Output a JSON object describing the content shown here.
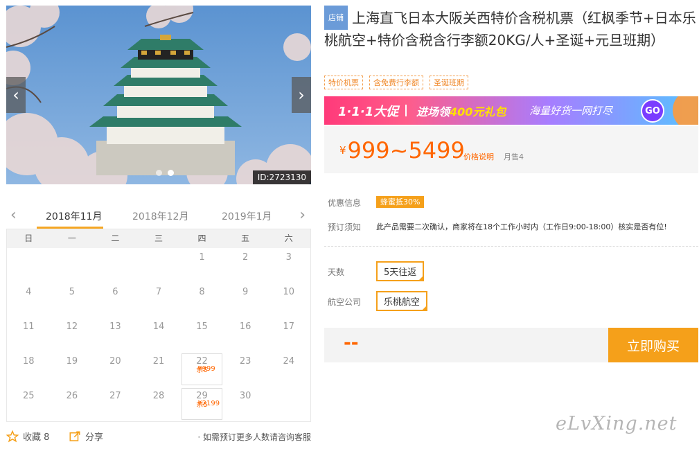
{
  "gallery": {
    "image_id": "ID:2723130",
    "prev_icon": "chevron-left-icon",
    "next_icon": "chevron-right-icon",
    "slide_count": 2,
    "active_slide": 2
  },
  "calendar": {
    "months": [
      "2018年11月",
      "2018年12月",
      "2019年1月"
    ],
    "active_month": "2018年11月",
    "weekdays": [
      "日",
      "一",
      "二",
      "三",
      "四",
      "五",
      "六"
    ],
    "weeks": [
      [
        {
          "d": ""
        },
        {
          "d": ""
        },
        {
          "d": ""
        },
        {
          "d": ""
        },
        {
          "d": "1"
        },
        {
          "d": "2"
        },
        {
          "d": "3"
        }
      ],
      [
        {
          "d": "4"
        },
        {
          "d": "5"
        },
        {
          "d": "6"
        },
        {
          "d": "7"
        },
        {
          "d": "8"
        },
        {
          "d": "9"
        },
        {
          "d": "10"
        }
      ],
      [
        {
          "d": "11"
        },
        {
          "d": "12"
        },
        {
          "d": "13"
        },
        {
          "d": "14"
        },
        {
          "d": "15"
        },
        {
          "d": "16"
        },
        {
          "d": "17"
        }
      ],
      [
        {
          "d": "18"
        },
        {
          "d": "19"
        },
        {
          "d": "20"
        },
        {
          "d": "21"
        },
        {
          "d": "22",
          "price": "¥999",
          "stock": "余5"
        },
        {
          "d": "23"
        },
        {
          "d": "24"
        }
      ],
      [
        {
          "d": "25"
        },
        {
          "d": "26"
        },
        {
          "d": "27"
        },
        {
          "d": "28"
        },
        {
          "d": "29",
          "price": "¥2199",
          "stock": "余5"
        },
        {
          "d": "30"
        },
        {
          "d": ""
        }
      ]
    ]
  },
  "bottom": {
    "favorite_label": "收藏 8",
    "share_label": "分享",
    "contact_tip": "· 如需预订更多人数请咨询客服"
  },
  "product": {
    "shop_badge": "店铺",
    "title": "上海直飞日本大阪关西特价含税机票（红枫季节+日本乐桃航空+特价含税含行李额20KG/人+圣诞+元旦班期）",
    "tags": [
      "特价机票",
      "含免费行李额",
      "圣诞班期"
    ]
  },
  "promo": {
    "logo": "1·1·1大促",
    "main_prefix": "进场领",
    "main_highlight": "400元礼包",
    "sub": "海量好货一网打尽",
    "go_label": "GO"
  },
  "price": {
    "currency": "¥",
    "range": "999~5499",
    "note": "价格说明",
    "sold": "月售4"
  },
  "info": {
    "discount_label": "优惠信息",
    "discount_badge": "蜂蜜抵30%",
    "booking_label": "预订须知",
    "booking_text": "此产品需要二次确认，商家将在18个工作小时内（工作日9:00-18:00）核实是否有位!"
  },
  "options": {
    "days_label": "天数",
    "days_value": "5天往返",
    "airline_label": "航空公司",
    "airline_value": "乐桃航空"
  },
  "buy": {
    "total": "--",
    "button": "立即购买"
  },
  "watermark": "eLvXing.net",
  "colors": {
    "accent": "#f5a01a",
    "price": "#ff6600",
    "badge_blue": "#6b9bd8"
  }
}
